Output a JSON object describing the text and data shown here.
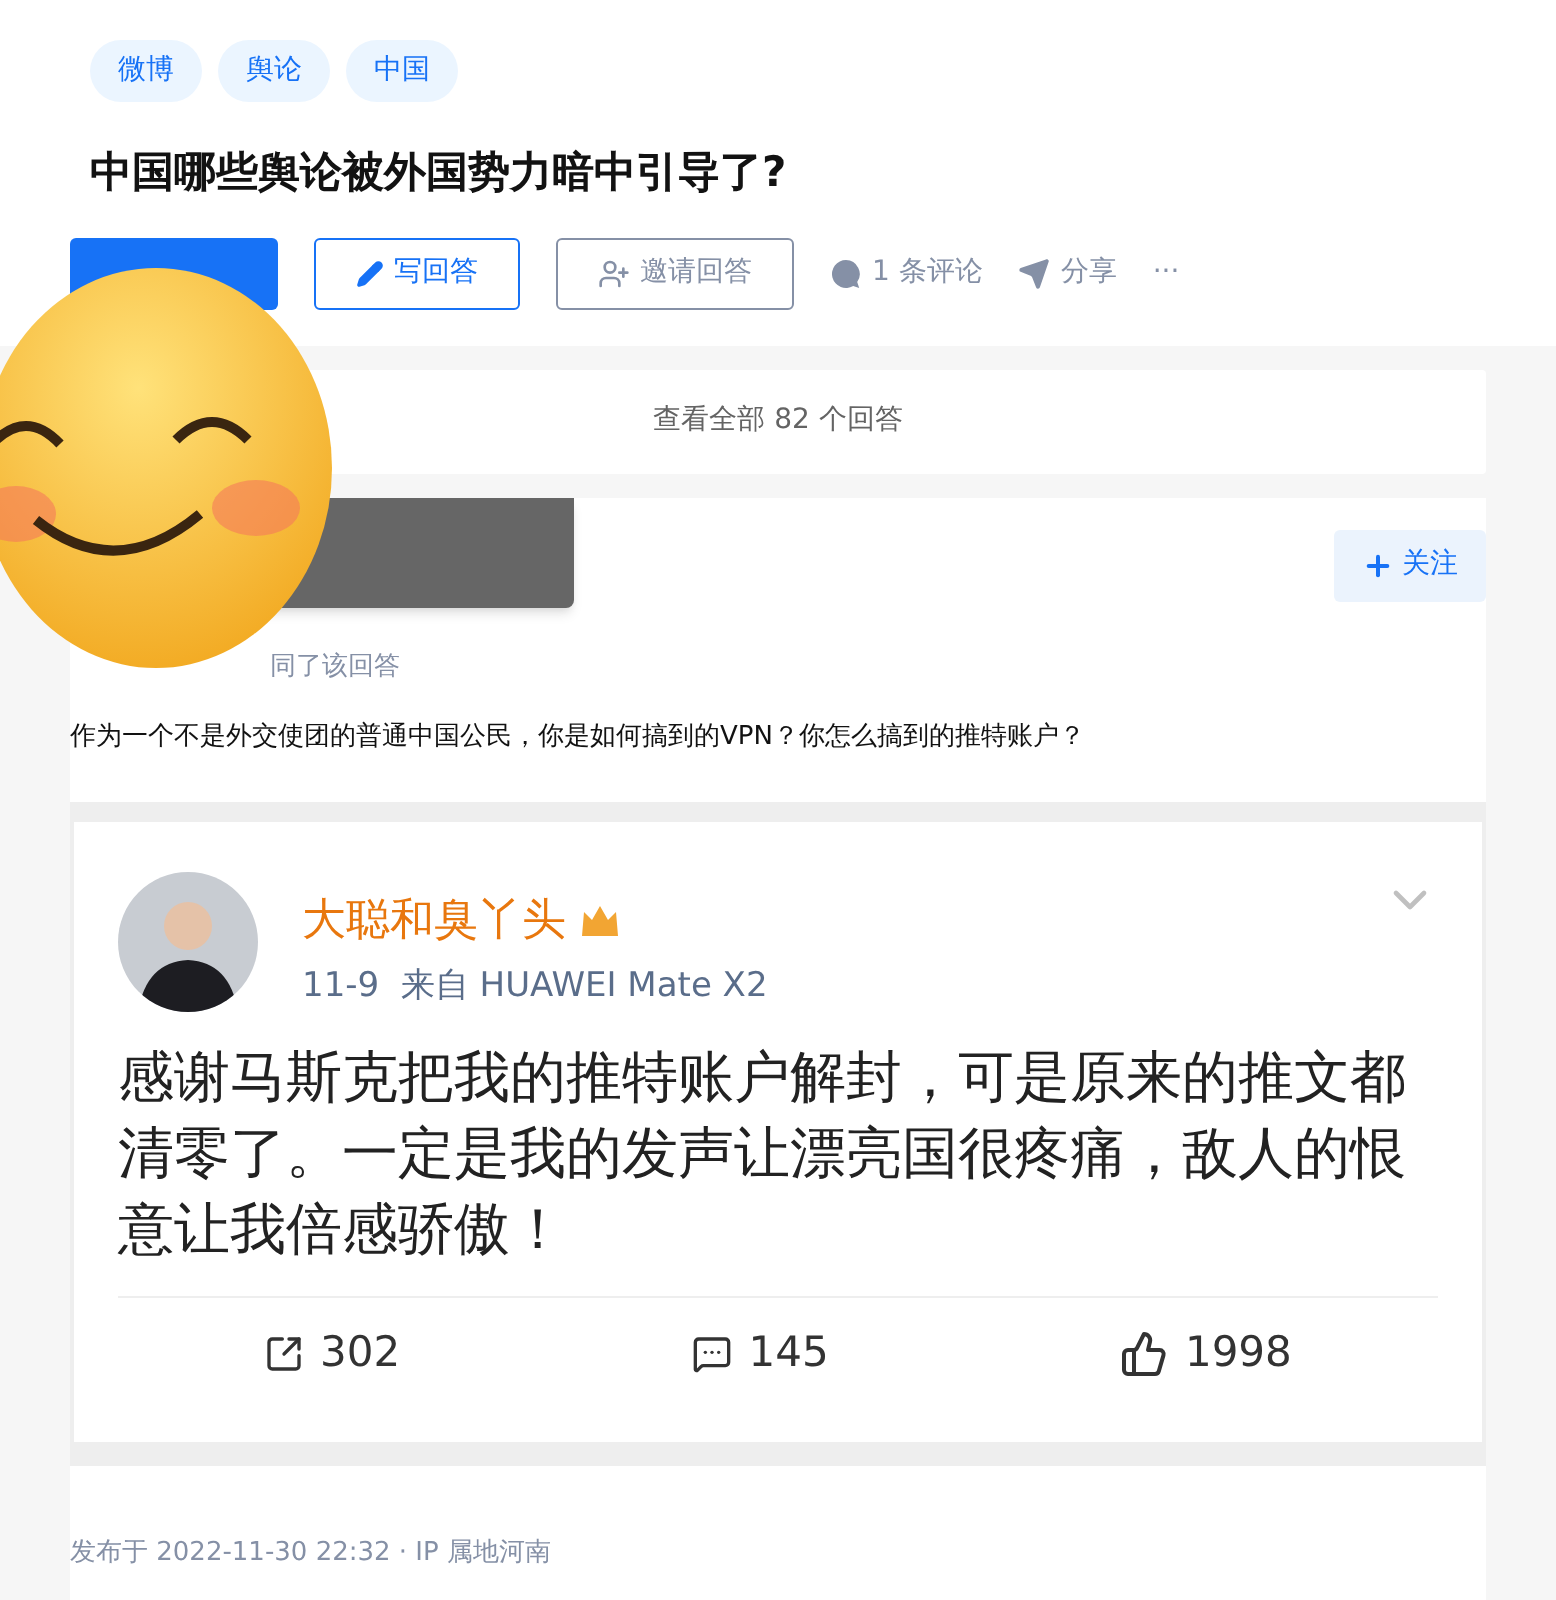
{
  "tags": [
    "微博",
    "舆论",
    "中国"
  ],
  "question": {
    "title": "中国哪些舆论被外国势力暗中引导了?"
  },
  "actions": [
    {
      "kind": "primary"
    },
    {
      "kind": "write",
      "label": "写回答"
    },
    {
      "kind": "invite",
      "label": "邀请回答"
    },
    {
      "kind": "comment",
      "label": "1 条评论"
    },
    {
      "kind": "share",
      "label": "分享"
    },
    {
      "kind": "more",
      "label": "···"
    }
  ],
  "view_all": "查看全部 82 个回答",
  "answer": {
    "follow_label": "关注",
    "upvote_text": "同了该回答",
    "question_text": "作为一个不是外交使团的普通中国公民，你是如何搞到的VPN？你怎么搞到的推特账户？",
    "weibo": {
      "name": "大聪和臭丫头",
      "meta": "11-9  来自 HUAWEI Mate X2",
      "body": "感谢马斯克把我的推特账户解封，可是原来的推文都清零了。一定是我的发声让漂亮国很疼痛，敌人的恨意让我倍感骄傲！",
      "stats": [
        {
          "kind": "repost",
          "count": "302"
        },
        {
          "kind": "comment",
          "count": "145"
        },
        {
          "kind": "like",
          "count": "1998"
        }
      ]
    },
    "published": "发布于 2022-11-30 22:32 · IP 属地河南"
  }
}
